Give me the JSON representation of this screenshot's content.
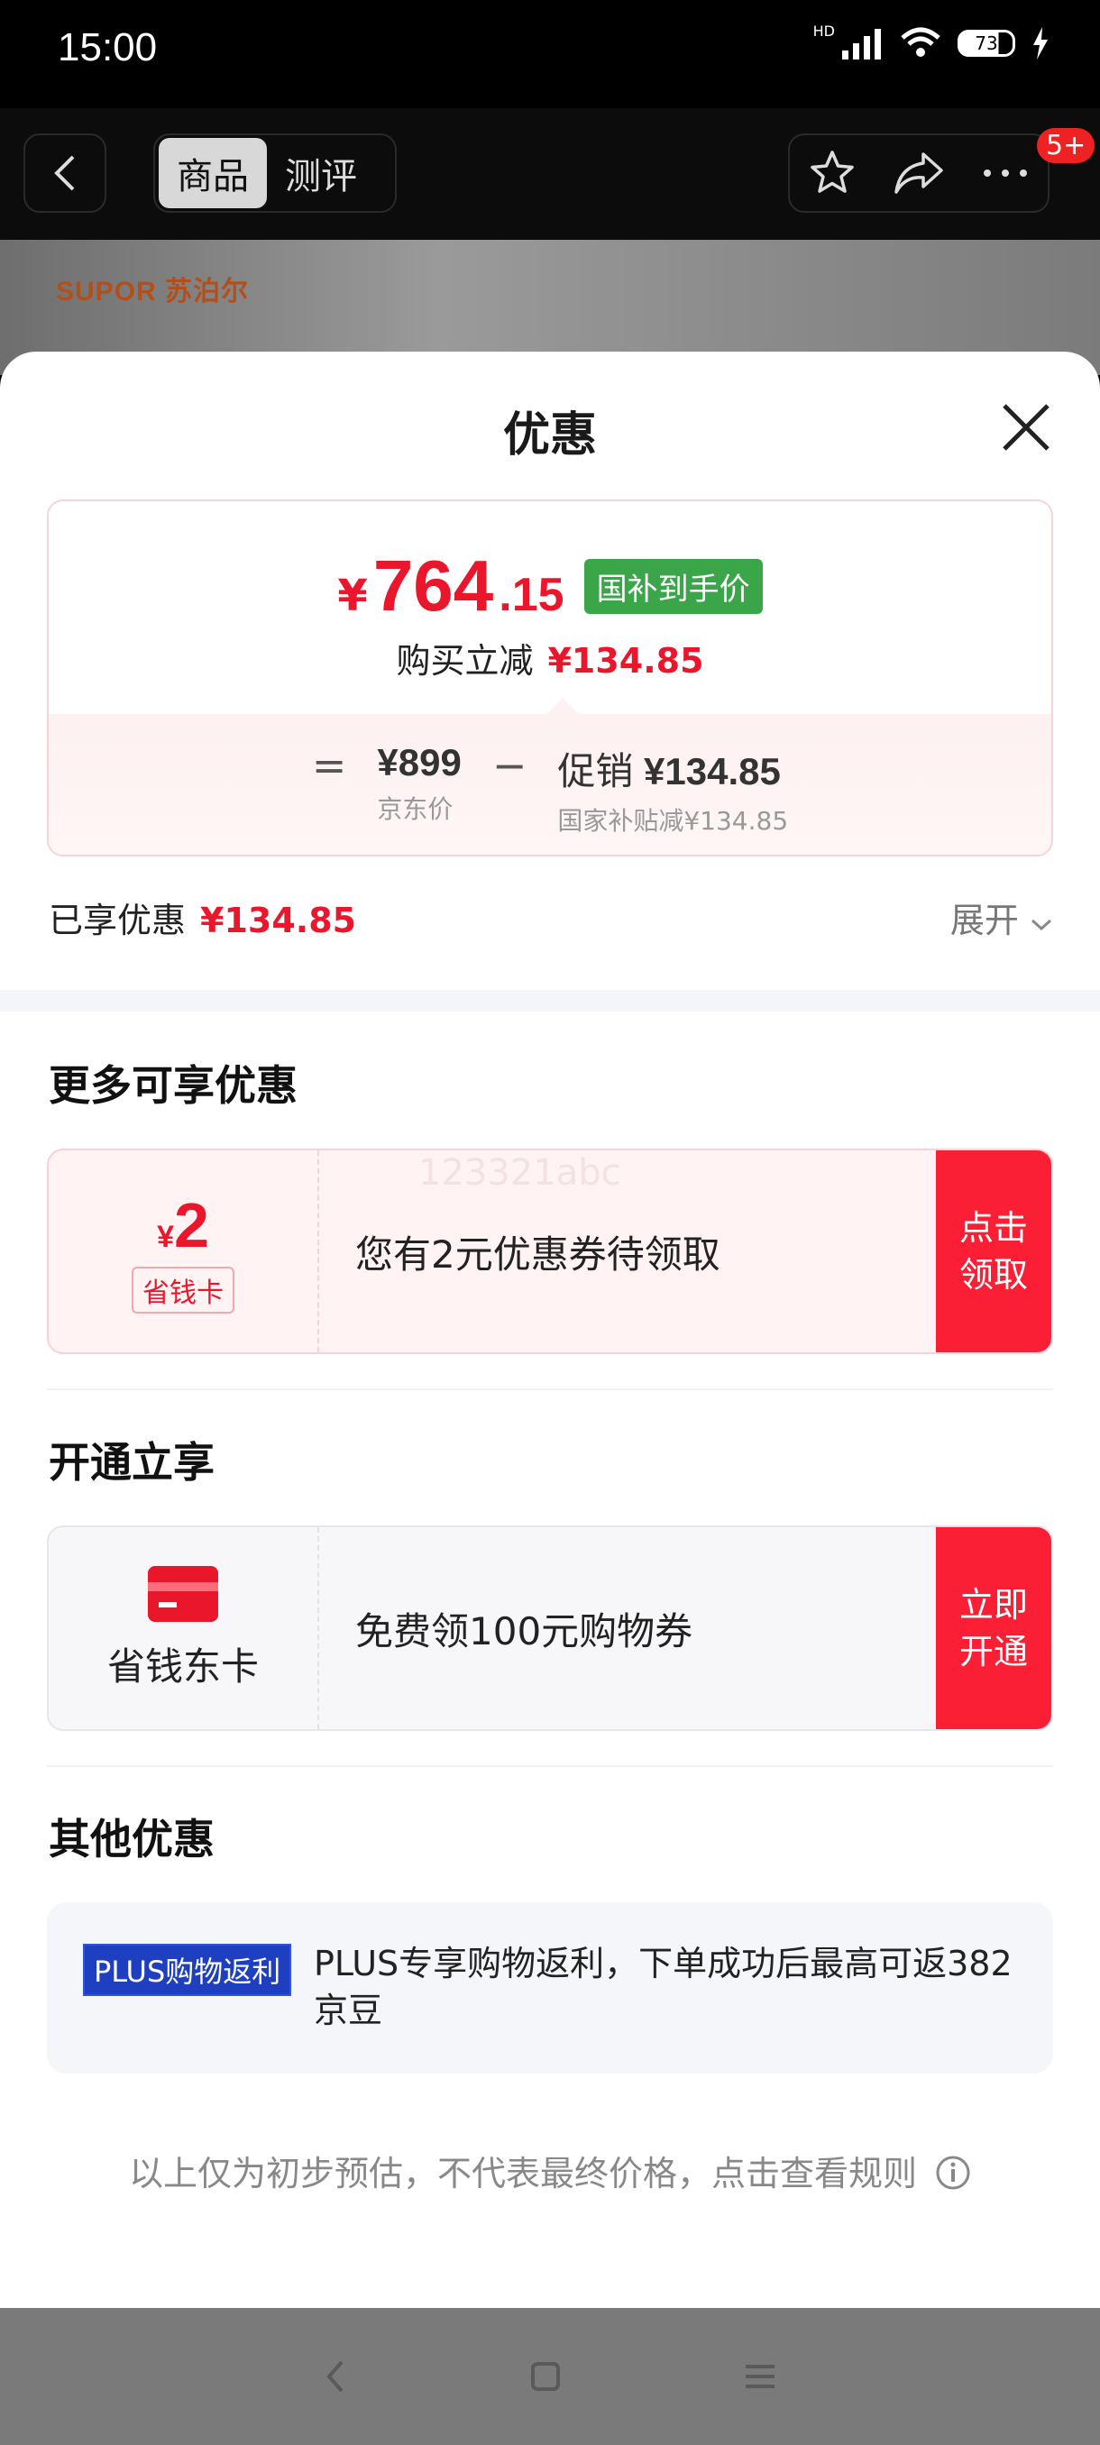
{
  "status_bar": {
    "time": "15:00",
    "network": "HD",
    "battery": "73"
  },
  "nav": {
    "tabs": [
      {
        "label": "商品",
        "active": true
      },
      {
        "label": "测评",
        "active": false
      }
    ],
    "badge": "5+"
  },
  "hero": {
    "brand": "SUPOR 苏泊尔"
  },
  "sheet": {
    "title": "优惠",
    "price_card": {
      "currency": "¥",
      "final_price_int": "764",
      "final_price_dec": ".15",
      "tag": "国补到手价",
      "reduce_label": "购买立减",
      "reduce_amount": "¥134.85",
      "formula": {
        "eq": "=",
        "minus": "−",
        "jd_price": "¥899",
        "jd_price_label": "京东价",
        "promo_label": "促销",
        "promo_amount": "¥134.85",
        "promo_sub": "国家补贴减¥134.85"
      }
    },
    "enjoyed": {
      "label": "已享优惠",
      "amount": "¥134.85"
    },
    "expand_label": "展开",
    "more_section": {
      "title": "更多可享优惠",
      "coupon": {
        "currency": "¥",
        "amount": "2",
        "tag": "省钱卡",
        "text": "您有2元优惠券待领取",
        "watermark": "123321abc",
        "button_line1": "点击",
        "button_line2": "领取"
      }
    },
    "open_section": {
      "title": "开通立享",
      "card": {
        "name": "省钱东卡",
        "text": "免费领100元购物券",
        "button_line1": "立即",
        "button_line2": "开通"
      }
    },
    "other_section": {
      "title": "其他优惠",
      "plus_tag": "PLUS购物返利",
      "plus_text": "PLUS专享购物返利，下单成功后最高可返382京豆"
    },
    "disclaimer": "以上仅为初步预估，不代表最终价格，点击查看规则"
  },
  "colors": {
    "accent_red": "#e9162c",
    "button_red": "#fa1f35",
    "green": "#3aa649",
    "plus_blue": "#1d3fc0"
  }
}
